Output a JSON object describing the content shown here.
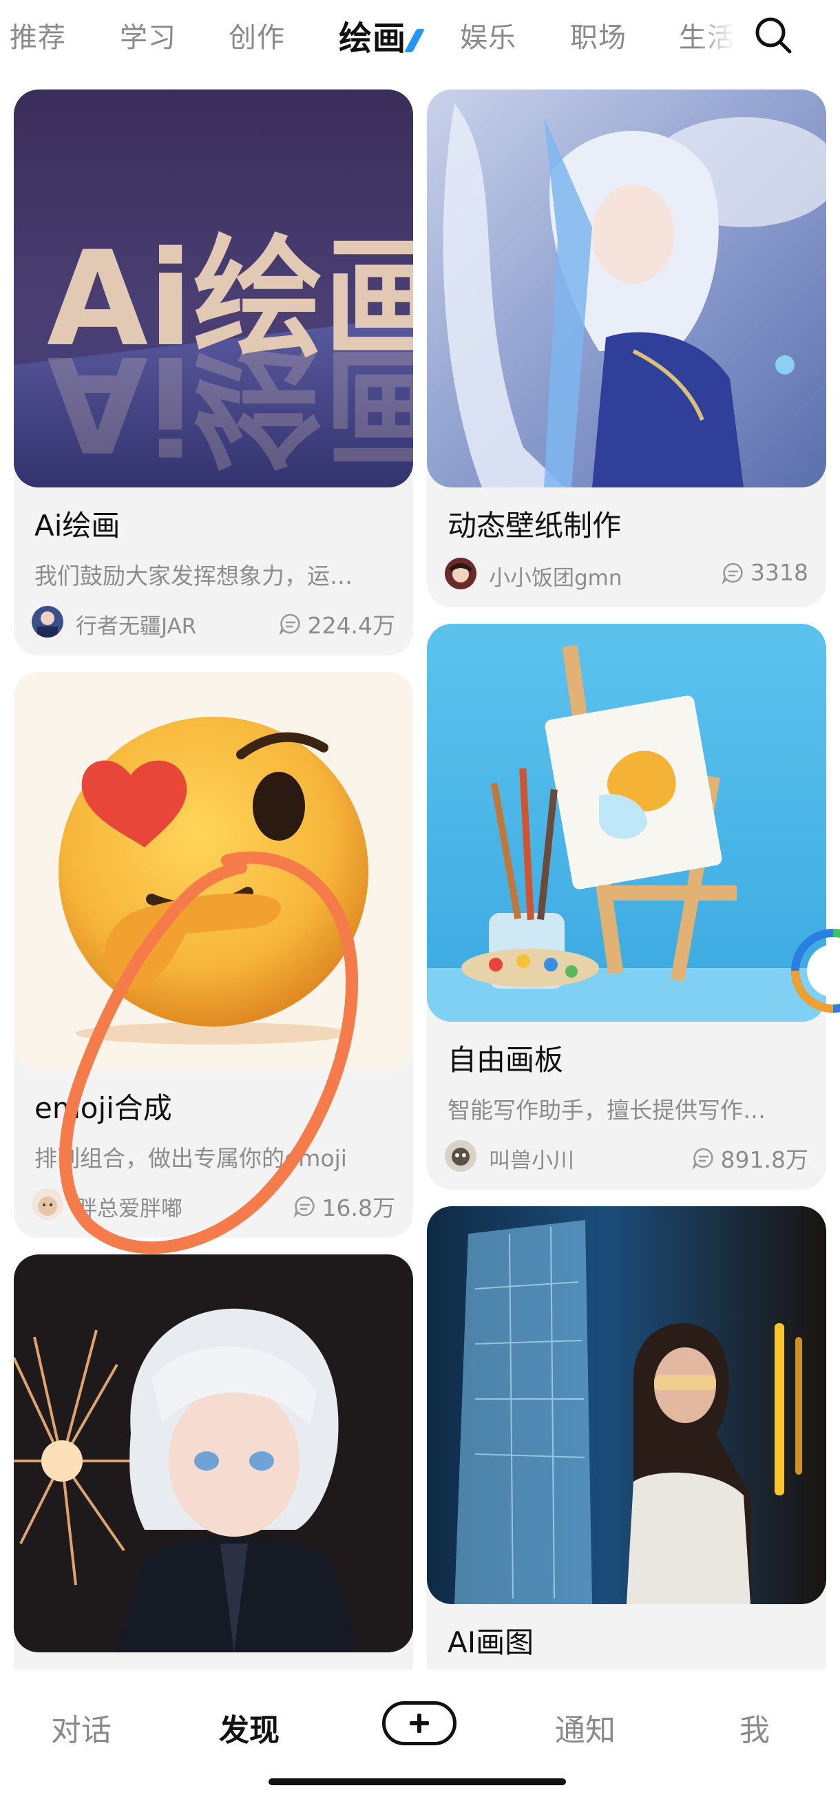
{
  "top_tabs": [
    {
      "label": "推荐"
    },
    {
      "label": "学习"
    },
    {
      "label": "创作"
    },
    {
      "label": "绘画",
      "active": true
    },
    {
      "label": "娱乐"
    },
    {
      "label": "职场"
    },
    {
      "label": "生活"
    }
  ],
  "search": {
    "icon": "search-icon"
  },
  "cards": [
    {
      "title": "Ai绘画",
      "thumb_text": "Ai绘画",
      "description": "我们鼓励大家发挥想象力，运…",
      "author": "行者无疆JAR",
      "comments": "224.4万"
    },
    {
      "title": "动态壁纸制作",
      "author": "小小饭团gmn",
      "comments": "3318"
    },
    {
      "title": "emoji合成",
      "description": "排列组合，做出专属你的emoji",
      "author": "胖总爱胖嘟",
      "comments": "16.8万"
    },
    {
      "title": "自由画板",
      "description": "智能写作助手，擅长提供写作…",
      "author": "叫兽小川",
      "comments": "891.8万"
    },
    {
      "title": "AI画图"
    }
  ],
  "bottom_nav": [
    {
      "label": "对话"
    },
    {
      "label": "发现",
      "active": true
    },
    {
      "label": "通知"
    },
    {
      "label": "我"
    }
  ],
  "colors": {
    "accent": "#2196f3",
    "annotation": "#f57c4a",
    "active_text": "#111111",
    "inactive_text": "#8a8a8a"
  }
}
